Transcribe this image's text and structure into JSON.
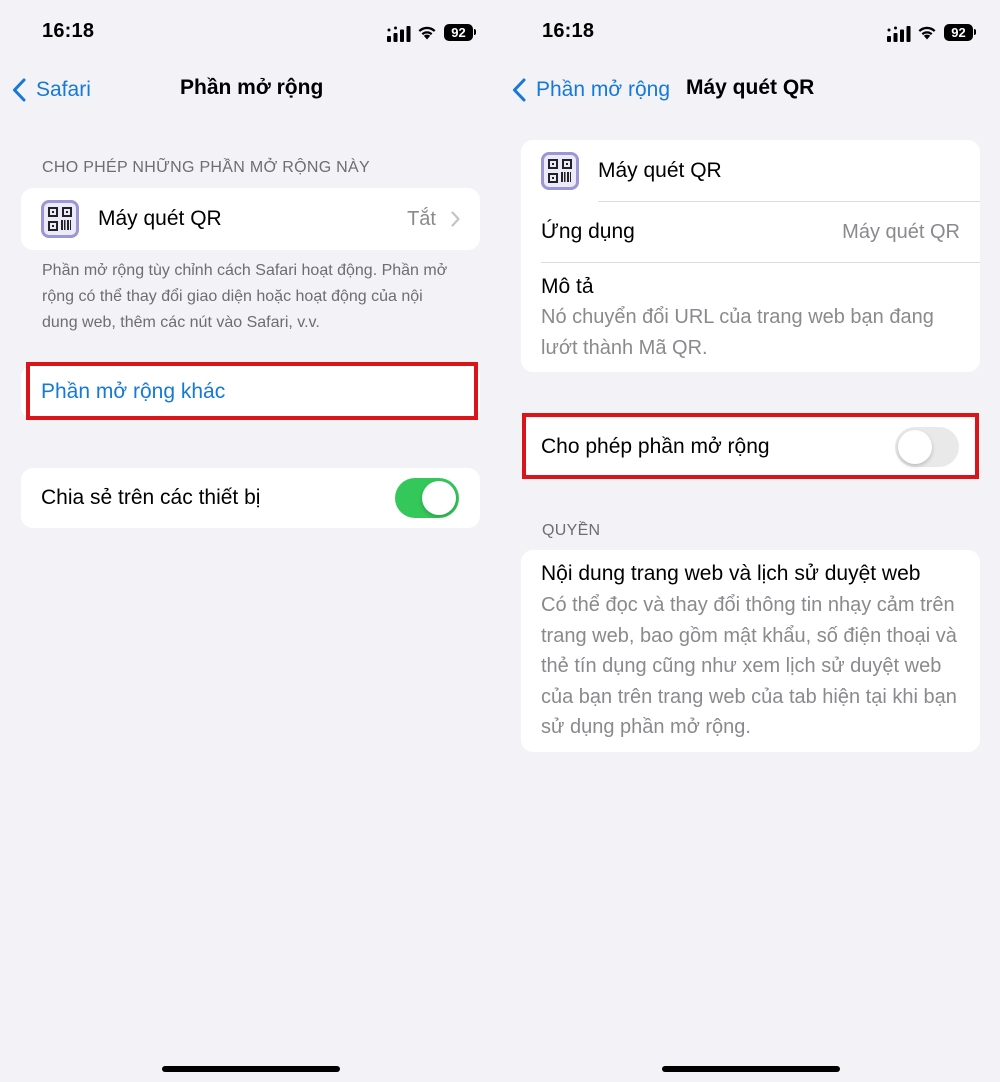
{
  "left_screen": {
    "status": {
      "time": "16:18",
      "battery": "92"
    },
    "nav": {
      "back_label": "Safari",
      "title": "Phần mở rộng"
    },
    "extensions_section": {
      "header": "CHO PHÉP NHỮNG PHẦN MỞ RỘNG NÀY",
      "items": [
        {
          "name": "Máy quét QR",
          "value": "Tắt",
          "icon": "qr-code-icon"
        }
      ],
      "footer": "Phần mở rộng tùy chỉnh cách Safari hoạt động. Phần mở rộng có thể thay đổi giao diện hoặc hoạt động của nội dung web, thêm các nút vào Safari, v.v."
    },
    "more_extensions_link": "Phần mở rộng khác",
    "share_across_devices": {
      "label": "Chia sẻ trên các thiết bị",
      "enabled": true
    }
  },
  "right_screen": {
    "status": {
      "time": "16:18",
      "battery": "92"
    },
    "nav": {
      "back_label": "Phần mở rộng",
      "title": "Máy quét QR"
    },
    "info": {
      "name": "Máy quét QR",
      "app_label": "Ứng dụng",
      "app_value": "Máy quét QR",
      "description_label": "Mô tả",
      "description_text": "Nó chuyển đổi URL của trang web bạn đang lướt thành Mã QR."
    },
    "allow_extension": {
      "label": "Cho phép phần mở rộng",
      "enabled": false
    },
    "permissions": {
      "header": "QUYỀN",
      "title": "Nội dung trang web và lịch sử duyệt web",
      "description": "Có thể đọc và thay đổi thông tin nhạy cảm trên trang web, bao gồm mật khẩu, số điện thoại và thẻ tín dụng cũng như xem lịch sử duyệt web của bạn trên trang web của tab hiện tại khi bạn sử dụng phần mở rộng."
    }
  },
  "colors": {
    "accent": "#1479d8",
    "toggle_on": "#34c759",
    "toggle_off": "#e9e9ea",
    "highlight": "#d9151a",
    "background": "#f2f2f7",
    "secondary_text": "#8a8a8e"
  }
}
